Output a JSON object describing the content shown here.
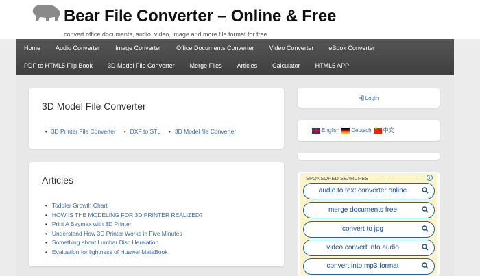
{
  "header": {
    "title": "Bear File Converter – Online & Free",
    "tagline": "convert office documents, audio, video, image and more file format for free"
  },
  "nav": {
    "row1": [
      "Home",
      "Audio Converter",
      "Image Converter",
      "Office Documents Converter",
      "Video Converter",
      "eBook Converter"
    ],
    "row2": [
      "PDF to HTML5 Flip Book",
      "3D Model File Converter",
      "Merge Files",
      "Articles",
      "Calculator",
      "HTML5 APP"
    ]
  },
  "main": {
    "converter_card": {
      "title": "3D Model File Converter",
      "links": [
        "3D Printer File Converter",
        "DXF to STL",
        "3D Model file Converter"
      ]
    },
    "articles_card": {
      "title": "Articles",
      "items": [
        "Toddler Growth Chart",
        "HOW IS THE MODELING FOR 3D PRINTER REALIZED?",
        "Print A Baymax with 3D Printer",
        "Understand How 3D Printer Works in Five Minutes",
        "Something about Lumbar Disc Herniation",
        "Evaluation for lightness of Huawei MateBook"
      ]
    }
  },
  "sidebar": {
    "login_label": "Login",
    "login_icon": "login-icon",
    "languages": [
      "English",
      "Deutsch",
      "中文"
    ],
    "sponsored": {
      "heading": "SPONSORED SEARCHES",
      "searches": [
        "audio to text converter online",
        "merge documents free",
        "convert to jpg",
        "video convert into audio",
        "convert into mp3 format"
      ]
    }
  },
  "colors": {
    "link": "#3a6da8",
    "nav_bg": "#4a4a4a",
    "sponsored_bg": "#fdf5c8",
    "pill_border": "#1a63b8"
  }
}
